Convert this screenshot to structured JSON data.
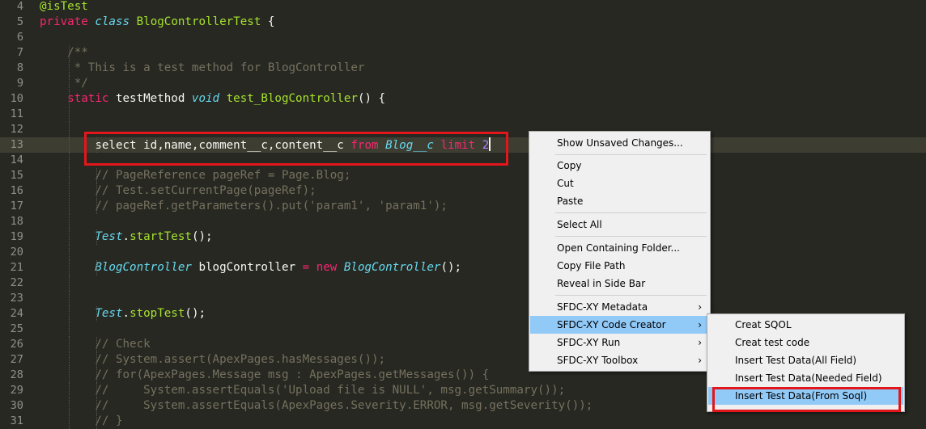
{
  "editor": {
    "lines": [
      {
        "num": "4",
        "parts": [
          {
            "t": "@isTest",
            "c": "fn"
          }
        ]
      },
      {
        "num": "5",
        "parts": [
          {
            "t": "private",
            "c": "kw"
          },
          {
            "t": " "
          },
          {
            "t": "class",
            "c": "typ"
          },
          {
            "t": " "
          },
          {
            "t": "BlogControllerTest",
            "c": "fn"
          },
          {
            "t": " {"
          }
        ]
      },
      {
        "num": "6",
        "parts": []
      },
      {
        "num": "7",
        "parts": [
          {
            "t": "    /**",
            "c": "cmt"
          }
        ]
      },
      {
        "num": "8",
        "parts": [
          {
            "t": "     * This is a test method for BlogController",
            "c": "cmt"
          }
        ]
      },
      {
        "num": "9",
        "parts": [
          {
            "t": "     */",
            "c": "cmt"
          }
        ]
      },
      {
        "num": "10",
        "parts": [
          {
            "t": "    "
          },
          {
            "t": "static",
            "c": "kw"
          },
          {
            "t": " testMethod "
          },
          {
            "t": "void",
            "c": "typ"
          },
          {
            "t": " "
          },
          {
            "t": "test_BlogController",
            "c": "fn"
          },
          {
            "t": "() {"
          }
        ]
      },
      {
        "num": "11",
        "parts": []
      },
      {
        "num": "12",
        "parts": []
      },
      {
        "num": "13",
        "active": true,
        "cursor": true,
        "parts": [
          {
            "t": "        select id,name,comment__c,content__c "
          },
          {
            "t": "from",
            "c": "kw"
          },
          {
            "t": " "
          },
          {
            "t": "Blog__c",
            "c": "typ"
          },
          {
            "t": " "
          },
          {
            "t": "limit",
            "c": "kw"
          },
          {
            "t": " "
          },
          {
            "t": "2",
            "c": "num"
          }
        ]
      },
      {
        "num": "14",
        "parts": []
      },
      {
        "num": "15",
        "parts": [
          {
            "t": "        // PageReference pageRef = Page.Blog;",
            "c": "cmt"
          }
        ]
      },
      {
        "num": "16",
        "parts": [
          {
            "t": "        // Test.setCurrentPage(pageRef);",
            "c": "cmt"
          }
        ]
      },
      {
        "num": "17",
        "parts": [
          {
            "t": "        // pageRef.getParameters().put('param1', 'param1');",
            "c": "cmt"
          }
        ]
      },
      {
        "num": "18",
        "parts": []
      },
      {
        "num": "19",
        "parts": [
          {
            "t": "        "
          },
          {
            "t": "Test",
            "c": "typ"
          },
          {
            "t": "."
          },
          {
            "t": "startTest",
            "c": "fn"
          },
          {
            "t": "();"
          }
        ]
      },
      {
        "num": "20",
        "parts": []
      },
      {
        "num": "21",
        "parts": [
          {
            "t": "        "
          },
          {
            "t": "BlogController",
            "c": "typ"
          },
          {
            "t": " blogController "
          },
          {
            "t": "=",
            "c": "kw"
          },
          {
            "t": " "
          },
          {
            "t": "new",
            "c": "kw"
          },
          {
            "t": " "
          },
          {
            "t": "BlogController",
            "c": "typ"
          },
          {
            "t": "();"
          }
        ]
      },
      {
        "num": "22",
        "parts": []
      },
      {
        "num": "23",
        "parts": []
      },
      {
        "num": "24",
        "parts": [
          {
            "t": "        "
          },
          {
            "t": "Test",
            "c": "typ"
          },
          {
            "t": "."
          },
          {
            "t": "stopTest",
            "c": "fn"
          },
          {
            "t": "();"
          }
        ]
      },
      {
        "num": "25",
        "parts": []
      },
      {
        "num": "26",
        "parts": [
          {
            "t": "        // Check",
            "c": "cmt"
          }
        ]
      },
      {
        "num": "27",
        "parts": [
          {
            "t": "        // System.assert(ApexPages.hasMessages());",
            "c": "cmt"
          }
        ]
      },
      {
        "num": "28",
        "parts": [
          {
            "t": "        // for(ApexPages.Message msg : ApexPages.getMessages()) {",
            "c": "cmt"
          }
        ]
      },
      {
        "num": "29",
        "parts": [
          {
            "t": "        //     System.assertEquals('Upload file is NULL', msg.getSummary());",
            "c": "cmt"
          }
        ]
      },
      {
        "num": "30",
        "parts": [
          {
            "t": "        //     System.assertEquals(ApexPages.Severity.ERROR, msg.getSeverity());",
            "c": "cmt"
          }
        ]
      },
      {
        "num": "31",
        "parts": [
          {
            "t": "        // }",
            "c": "cmt"
          }
        ]
      }
    ]
  },
  "context_menu": {
    "show_unsaved": "Show Unsaved Changes...",
    "copy": "Copy",
    "cut": "Cut",
    "paste": "Paste",
    "select_all": "Select All",
    "open_folder": "Open Containing Folder...",
    "copy_path": "Copy File Path",
    "reveal": "Reveal in Side Bar",
    "sfdc_metadata": "SFDC-XY Metadata",
    "sfdc_code_creator": "SFDC-XY Code Creator",
    "sfdc_run": "SFDC-XY Run",
    "sfdc_toolbox": "SFDC-XY Toolbox",
    "arrow": "›"
  },
  "submenu": {
    "creat_sqol": "Creat SQOL",
    "creat_test_code": "Creat test code",
    "insert_all": "Insert Test Data(All Field)",
    "insert_needed": "Insert Test Data(Needed Field)",
    "insert_soql": "Insert Test Data(From Soql)"
  },
  "colors": {
    "editor_bg": "#272822",
    "highlight_box": "#e3161b",
    "menu_bg": "#f0f0f0",
    "menu_selected": "#91c9f7"
  }
}
